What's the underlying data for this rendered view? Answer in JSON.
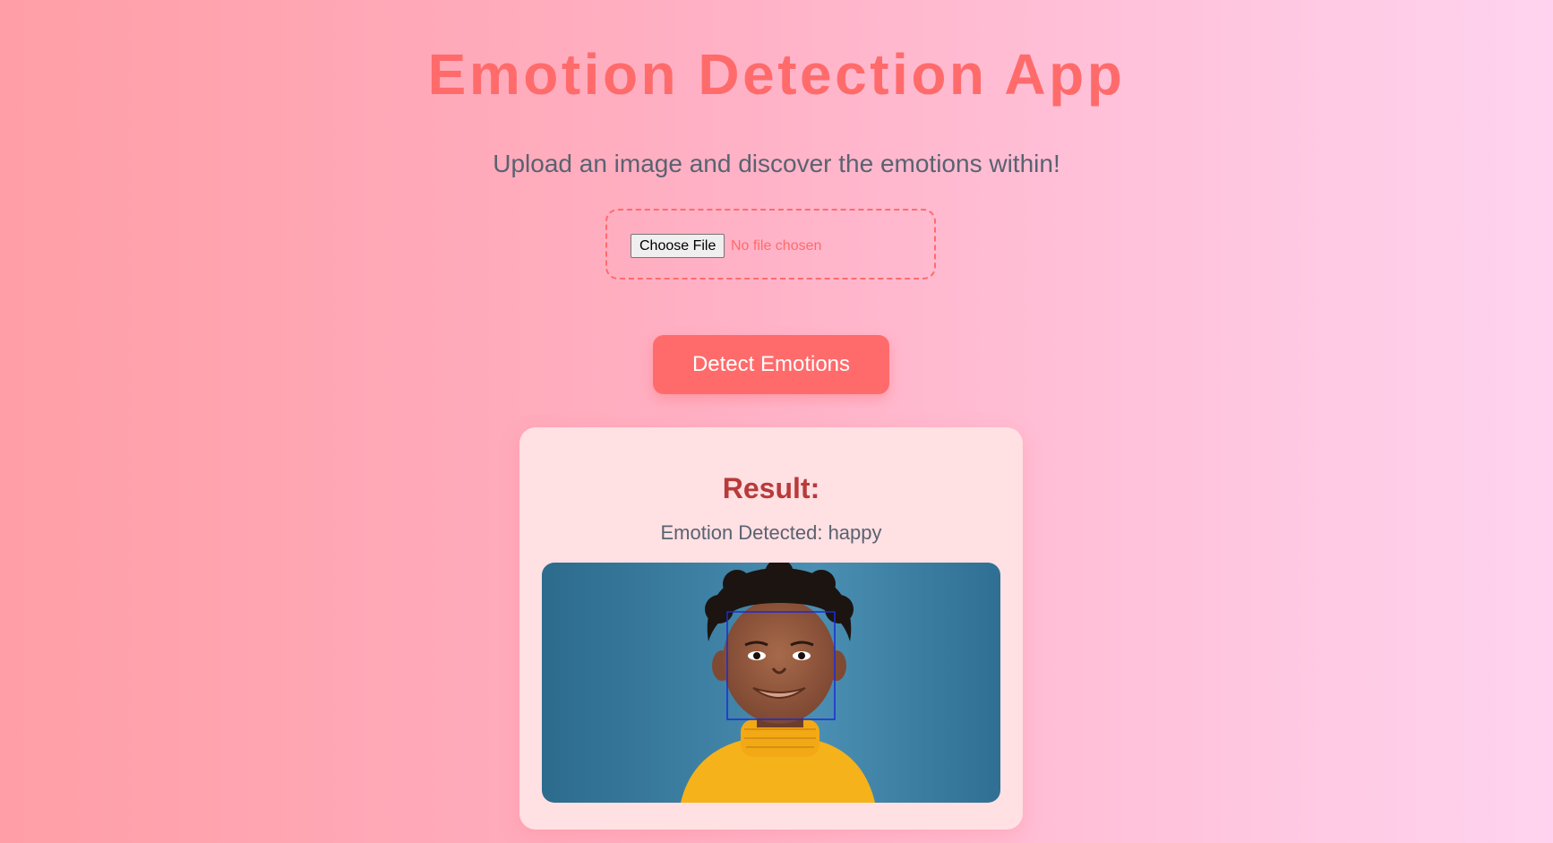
{
  "app": {
    "title": "Emotion Detection App",
    "subtitle": "Upload an image and discover the emotions within!"
  },
  "upload": {
    "button_label": "Choose File",
    "status_text": "No file chosen"
  },
  "actions": {
    "detect_label": "Detect Emotions"
  },
  "result": {
    "heading": "Result:",
    "emotion_text": "Emotion Detected: happy",
    "image_icon": "child-portrait-image",
    "box_icon": "face-bounding-box"
  },
  "colors": {
    "accent": "#ff6b6b",
    "heading_red": "#b83a3a",
    "text_gray": "#5a6270",
    "card_bg": "#ffe0e3",
    "face_box": "#1a2bd6"
  }
}
